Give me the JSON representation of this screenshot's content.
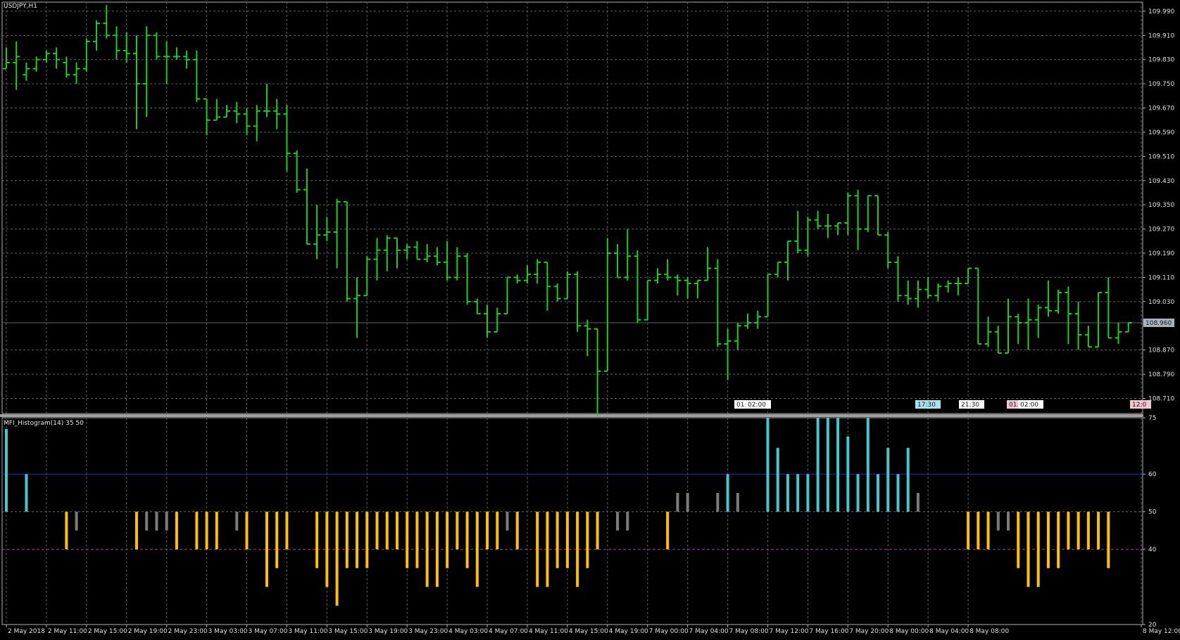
{
  "window": {
    "symbol_title": "USDJPY,H1",
    "indicator_title": "MFI_Histogram(14) 35 50"
  },
  "colors": {
    "background": "#000000",
    "grid": "#5a6470",
    "frame": "#b0b0b0",
    "separator": "#a0a0a0",
    "bars": "#22cc22",
    "price_line": "#5a6470",
    "price_tag_bg": "#a7b3c0",
    "hist_high": "#45c7cc",
    "hist_low": "#ffc107",
    "hist_neutral": "#7c7c7c",
    "level_60": "#1e2ed0",
    "level_40": "#b63ab6"
  },
  "price_axis": {
    "labels": [
      "109.990",
      "109.910",
      "109.830",
      "109.750",
      "109.670",
      "109.590",
      "109.510",
      "109.430",
      "109.350",
      "109.270",
      "109.190",
      "109.110",
      "109.030",
      "108.870",
      "108.790",
      "108.710"
    ],
    "current_price": "108.960"
  },
  "indicator_axis": {
    "labels": [
      "75",
      "60",
      "50",
      "40",
      "20"
    ]
  },
  "time_axis": {
    "labels": [
      "2 May 2018",
      "2 May 11:00",
      "2 May 15:00",
      "2 May 19:00",
      "2 May 23:00",
      "3 May 03:00",
      "3 May 07:00",
      "3 May 11:00",
      "3 May 15:00",
      "3 May 19:00",
      "3 May 23:00",
      "4 May 03:00",
      "4 May 07:00",
      "4 May 11:00",
      "4 May 15:00",
      "4 May 19:00",
      "7 May 00:00",
      "7 May 04:00",
      "7 May 08:00",
      "7 May 12:00",
      "7 May 16:00",
      "7 May 20:00",
      "8 May 00:00",
      "8 May 04:00",
      "8 May 08:00",
      "8 May 12:00"
    ]
  },
  "event_markers": [
    {
      "text": "01:",
      "color": "#ffffff"
    },
    {
      "text": "02:00",
      "color": "#ffffff"
    },
    {
      "text": "17:30",
      "color": "#a8e4f0"
    },
    {
      "text": "21:30",
      "color": "#ffffff"
    },
    {
      "text": "01:",
      "color": "#f5c6cf"
    },
    {
      "text": "02:00",
      "color": "#ffffff"
    },
    {
      "text": "12:0",
      "color": "#f5c6cf"
    }
  ],
  "chart_data": [
    {
      "type": "ohlc",
      "symbol": "USDJPY",
      "timeframe": "H1",
      "ylim": [
        108.66,
        110.02
      ],
      "current_price": 108.96,
      "bars": [
        [
          109.8,
          109.87,
          109.8,
          109.82
        ],
        [
          109.82,
          109.89,
          109.73,
          109.84
        ],
        [
          109.78,
          109.82,
          109.76,
          109.8
        ],
        [
          109.8,
          109.84,
          109.79,
          109.83
        ],
        [
          109.83,
          109.86,
          109.82,
          109.85
        ],
        [
          109.85,
          109.87,
          109.8,
          109.83
        ],
        [
          109.82,
          109.84,
          109.77,
          109.78
        ],
        [
          109.78,
          109.82,
          109.75,
          109.8
        ],
        [
          109.8,
          109.9,
          109.79,
          109.89
        ],
        [
          109.89,
          109.96,
          109.86,
          109.95
        ],
        [
          109.95,
          110.01,
          109.9,
          109.91
        ],
        [
          109.91,
          109.94,
          109.83,
          109.86
        ],
        [
          109.86,
          109.92,
          109.82,
          109.85
        ],
        [
          109.85,
          109.91,
          109.6,
          109.75
        ],
        [
          109.75,
          109.94,
          109.64,
          109.91
        ],
        [
          109.91,
          109.92,
          109.83,
          109.84
        ],
        [
          109.84,
          109.89,
          109.75,
          109.84
        ],
        [
          109.84,
          109.87,
          109.83,
          109.84
        ],
        [
          109.84,
          109.86,
          109.8,
          109.83
        ],
        [
          109.83,
          109.86,
          109.69,
          109.7
        ],
        [
          109.7,
          109.7,
          109.58,
          109.63
        ],
        [
          109.63,
          109.7,
          109.63,
          109.64
        ],
        [
          109.64,
          109.68,
          109.64,
          109.66
        ],
        [
          109.66,
          109.69,
          109.62,
          109.65
        ],
        [
          109.65,
          109.67,
          109.58,
          109.61
        ],
        [
          109.61,
          109.68,
          109.56,
          109.66
        ],
        [
          109.66,
          109.75,
          109.64,
          109.66
        ],
        [
          109.66,
          109.7,
          109.6,
          109.65
        ],
        [
          109.65,
          109.68,
          109.46,
          109.52
        ],
        [
          109.52,
          109.53,
          109.39,
          109.4
        ],
        [
          109.4,
          109.47,
          109.38,
          109.22
        ],
        [
          109.22,
          109.35,
          109.17,
          109.25
        ],
        [
          109.25,
          109.31,
          109.23,
          109.26
        ],
        [
          109.26,
          109.37,
          109.14,
          109.36
        ],
        [
          109.36,
          109.36,
          109.03,
          109.04
        ],
        [
          109.04,
          109.11,
          108.91,
          109.05
        ],
        [
          109.05,
          109.18,
          109.05,
          109.17
        ],
        [
          109.17,
          109.24,
          109.1,
          109.2
        ],
        [
          109.2,
          109.25,
          109.13,
          109.24
        ],
        [
          109.24,
          109.22,
          109.14,
          109.2
        ],
        [
          109.2,
          109.22,
          109.17,
          109.21
        ],
        [
          109.21,
          109.23,
          109.17,
          109.17
        ],
        [
          109.17,
          109.22,
          109.16,
          109.18
        ],
        [
          109.18,
          109.21,
          109.15,
          109.16
        ],
        [
          109.16,
          109.23,
          109.1,
          109.11
        ],
        [
          109.11,
          109.21,
          109.1,
          109.18
        ],
        [
          109.18,
          109.19,
          109.02,
          109.03
        ],
        [
          109.03,
          109.04,
          109.0,
          108.99
        ],
        [
          108.99,
          109.02,
          108.91,
          108.93
        ],
        [
          108.93,
          109.01,
          108.93,
          108.99
        ],
        [
          108.99,
          109.11,
          108.99,
          109.11
        ],
        [
          109.11,
          109.12,
          109.09,
          109.1
        ],
        [
          109.1,
          109.15,
          109.09,
          109.12
        ],
        [
          109.12,
          109.17,
          109.09,
          109.16
        ],
        [
          109.16,
          109.09,
          109.0,
          109.08
        ],
        [
          109.08,
          109.09,
          109.03,
          109.04
        ],
        [
          109.04,
          109.13,
          109.04,
          109.12
        ],
        [
          109.12,
          109.13,
          108.93,
          108.95
        ],
        [
          108.95,
          108.97,
          108.85,
          108.94
        ],
        [
          108.94,
          108.9,
          108.65,
          108.8
        ],
        [
          108.8,
          109.24,
          108.8,
          109.19
        ],
        [
          109.19,
          109.22,
          109.11,
          109.11
        ],
        [
          109.11,
          109.27,
          109.1,
          109.18
        ],
        [
          109.18,
          109.2,
          108.96,
          108.97
        ],
        [
          108.97,
          109.1,
          108.98,
          109.1
        ],
        [
          109.1,
          109.14,
          109.09,
          109.12
        ],
        [
          109.12,
          109.17,
          109.1,
          109.11
        ],
        [
          109.11,
          109.12,
          109.05,
          109.1
        ],
        [
          109.1,
          109.11,
          109.04,
          109.09
        ],
        [
          109.09,
          109.08,
          109.04,
          109.1
        ],
        [
          109.1,
          109.21,
          109.1,
          109.14
        ],
        [
          109.14,
          109.17,
          108.88,
          108.89
        ],
        [
          108.89,
          108.94,
          108.77,
          108.9
        ],
        [
          108.9,
          108.96,
          108.87,
          108.95
        ],
        [
          108.95,
          108.99,
          108.94,
          108.96
        ],
        [
          108.96,
          109.0,
          108.94,
          108.98
        ],
        [
          108.98,
          109.12,
          108.98,
          109.12
        ],
        [
          109.12,
          109.15,
          109.11,
          109.16
        ],
        [
          109.16,
          109.18,
          109.1,
          109.23
        ],
        [
          109.23,
          109.33,
          109.19,
          109.2
        ],
        [
          109.2,
          109.31,
          109.18,
          109.3
        ],
        [
          109.3,
          109.33,
          109.27,
          109.28
        ],
        [
          109.28,
          109.32,
          109.24,
          109.28
        ],
        [
          109.28,
          109.29,
          109.25,
          109.29
        ],
        [
          109.29,
          109.39,
          109.25,
          109.38
        ],
        [
          109.38,
          109.4,
          109.2,
          109.27
        ],
        [
          109.27,
          109.38,
          109.26,
          109.38
        ],
        [
          109.38,
          109.37,
          109.26,
          109.25
        ],
        [
          109.25,
          109.26,
          109.14,
          109.16
        ],
        [
          109.16,
          109.18,
          109.03,
          109.05
        ],
        [
          109.05,
          109.1,
          109.02,
          109.04
        ],
        [
          109.04,
          109.1,
          109.01,
          109.07
        ],
        [
          109.07,
          109.11,
          109.04,
          109.05
        ],
        [
          109.05,
          109.09,
          109.03,
          109.08
        ],
        [
          109.08,
          109.1,
          109.06,
          109.09
        ],
        [
          109.09,
          109.11,
          109.05,
          109.09
        ],
        [
          109.09,
          109.14,
          109.09,
          109.14
        ],
        [
          109.14,
          109.13,
          108.91,
          108.89
        ],
        [
          108.89,
          108.98,
          108.88,
          108.93
        ],
        [
          108.93,
          108.95,
          108.86,
          108.86
        ],
        [
          108.86,
          109.04,
          108.86,
          108.98
        ],
        [
          108.98,
          108.99,
          108.89,
          108.96
        ],
        [
          108.96,
          109.04,
          108.87,
          108.97
        ],
        [
          108.97,
          109.02,
          108.91,
          109.01
        ],
        [
          109.01,
          109.1,
          108.98,
          109.0
        ],
        [
          109.0,
          109.07,
          108.99,
          109.06
        ],
        [
          109.06,
          109.08,
          108.89,
          108.99
        ],
        [
          108.99,
          109.03,
          108.87,
          108.92
        ],
        [
          108.92,
          108.95,
          108.9,
          108.88
        ],
        [
          108.88,
          109.06,
          108.88,
          109.06
        ],
        [
          109.06,
          109.11,
          108.93,
          108.91
        ],
        [
          108.91,
          108.96,
          108.89,
          108.93
        ],
        [
          108.93,
          108.94,
          108.94,
          108.96
        ]
      ]
    },
    {
      "type": "histogram",
      "name": "MFI_Histogram(14) 35 50",
      "ylim": [
        20,
        75
      ],
      "baseline": 50,
      "levels": [
        60,
        40
      ],
      "values": [
        72,
        50,
        60,
        50,
        50,
        50,
        40,
        45,
        50,
        50,
        50,
        50,
        50,
        40,
        45,
        45,
        45,
        40,
        50,
        40,
        40,
        40,
        50,
        45,
        40,
        50,
        30,
        35,
        40,
        50,
        50,
        35,
        30,
        25,
        35,
        35,
        35,
        40,
        40,
        40,
        35,
        35,
        30,
        30,
        35,
        40,
        35,
        30,
        40,
        40,
        45,
        40,
        50,
        30,
        30,
        35,
        35,
        30,
        35,
        40,
        50,
        45,
        45,
        50,
        50,
        50,
        40,
        55,
        55,
        50,
        50,
        55,
        60,
        55,
        50,
        50,
        75,
        67,
        60,
        60,
        60,
        75,
        75,
        75,
        70,
        60,
        75,
        60,
        67,
        60,
        67,
        55,
        50,
        50,
        50,
        50,
        40,
        40,
        40,
        45,
        45,
        35,
        30,
        30,
        35,
        35,
        40,
        40,
        40,
        40,
        35
      ]
    }
  ]
}
